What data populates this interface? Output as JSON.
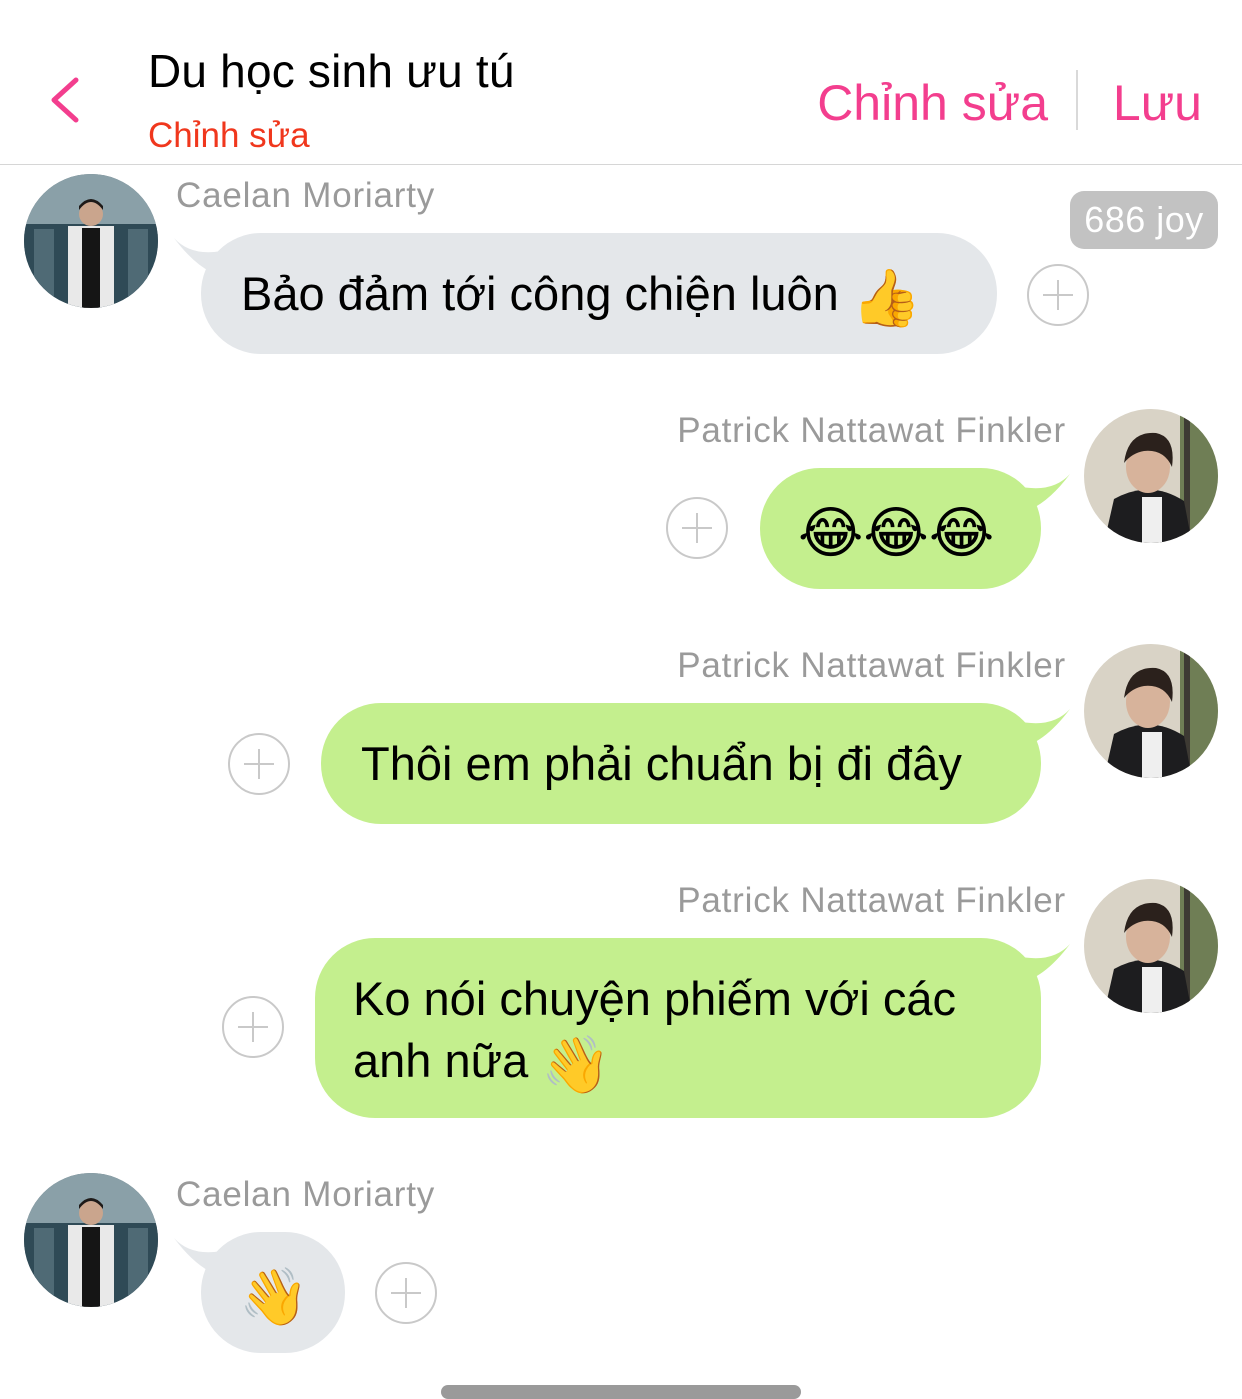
{
  "header": {
    "title": "Du học sinh ưu tú",
    "subtitle": "Chỉnh sửa",
    "edit_label": "Chỉnh sửa",
    "save_label": "Lưu",
    "accent_color": "#f33e8e",
    "subtitle_color": "#f0371d"
  },
  "messages": [
    {
      "sender": "Caelan Moriarty",
      "side": "left",
      "text": "Bảo đảm tới công chiện luôn",
      "emoji": "👍",
      "reaction_badge": "686 joy"
    },
    {
      "sender": "Patrick Nattawat Finkler",
      "side": "right",
      "text": "",
      "emoji": "😂😂😂"
    },
    {
      "sender": "Patrick Nattawat Finkler",
      "side": "right",
      "text": "Thôi em phải chuẩn bị đi đây",
      "emoji": ""
    },
    {
      "sender": "Patrick Nattawat Finkler",
      "side": "right",
      "text_line1": "Ko nói chuyện phiếm với các",
      "text_line2": "anh nữa",
      "emoji": "👋"
    },
    {
      "sender": "Caelan Moriarty",
      "side": "left",
      "text": "",
      "emoji": "👋"
    }
  ],
  "colors": {
    "left_bubble": "#e4e7ea",
    "right_bubble": "#c4ef8e",
    "sender_name": "#9a9a9a",
    "badge": "#c2c2c2"
  }
}
